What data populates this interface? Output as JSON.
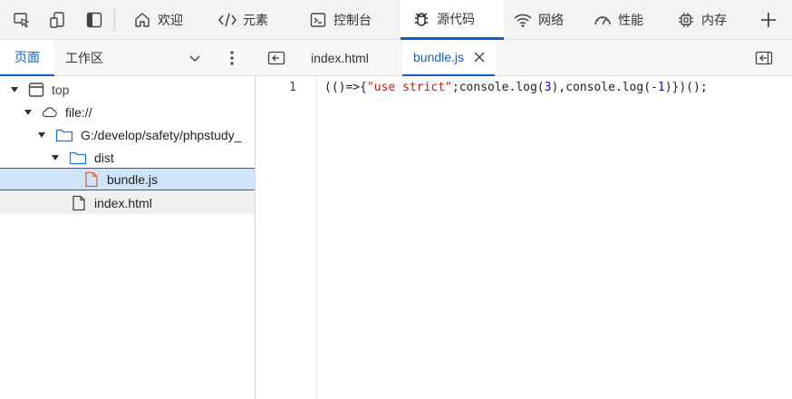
{
  "toolbar": {
    "icons": [
      "inspect-icon",
      "device-emulation-icon",
      "dock-side-icon"
    ],
    "tabs": [
      {
        "label": "欢迎",
        "icon": "home-icon"
      },
      {
        "label": "元素",
        "icon": "code-tags-icon"
      },
      {
        "label": "控制台",
        "icon": "console-icon"
      },
      {
        "label": "源代码",
        "icon": "bug-icon",
        "active": true
      },
      {
        "label": "网络",
        "icon": "wifi-icon"
      },
      {
        "label": "性能",
        "icon": "gauge-icon"
      },
      {
        "label": "内存",
        "icon": "chip-icon"
      }
    ],
    "add_icon": "plus-icon"
  },
  "left_panel": {
    "tabs": [
      {
        "label": "页面",
        "active": true
      },
      {
        "label": "工作区"
      }
    ],
    "tree": [
      {
        "label": "top",
        "icon": "frame-icon",
        "expanded": true,
        "depth": 0
      },
      {
        "label": "file://",
        "icon": "cloud-icon",
        "expanded": true,
        "depth": 1
      },
      {
        "label": "G:/develop/safety/phpstudy_",
        "icon": "folder-icon",
        "expanded": true,
        "depth": 2
      },
      {
        "label": "dist",
        "icon": "folder-icon",
        "expanded": true,
        "depth": 3
      },
      {
        "label": "bundle.js",
        "icon": "js-file-icon",
        "depth": 4,
        "selected": true
      },
      {
        "label": "index.html",
        "icon": "file-icon",
        "depth": 3
      }
    ]
  },
  "editor": {
    "tabs": [
      {
        "label": "index.html"
      },
      {
        "label": "bundle.js",
        "active": true
      }
    ],
    "lines": [
      {
        "number": "1",
        "code": "(()=>{\"use strict\";console.log(3),console.log(-1)})();"
      }
    ]
  },
  "colors": {
    "accent": "#0b62c4",
    "selection": "#cfe4f9",
    "string": "#c41a16",
    "number": "#1c00cf"
  }
}
